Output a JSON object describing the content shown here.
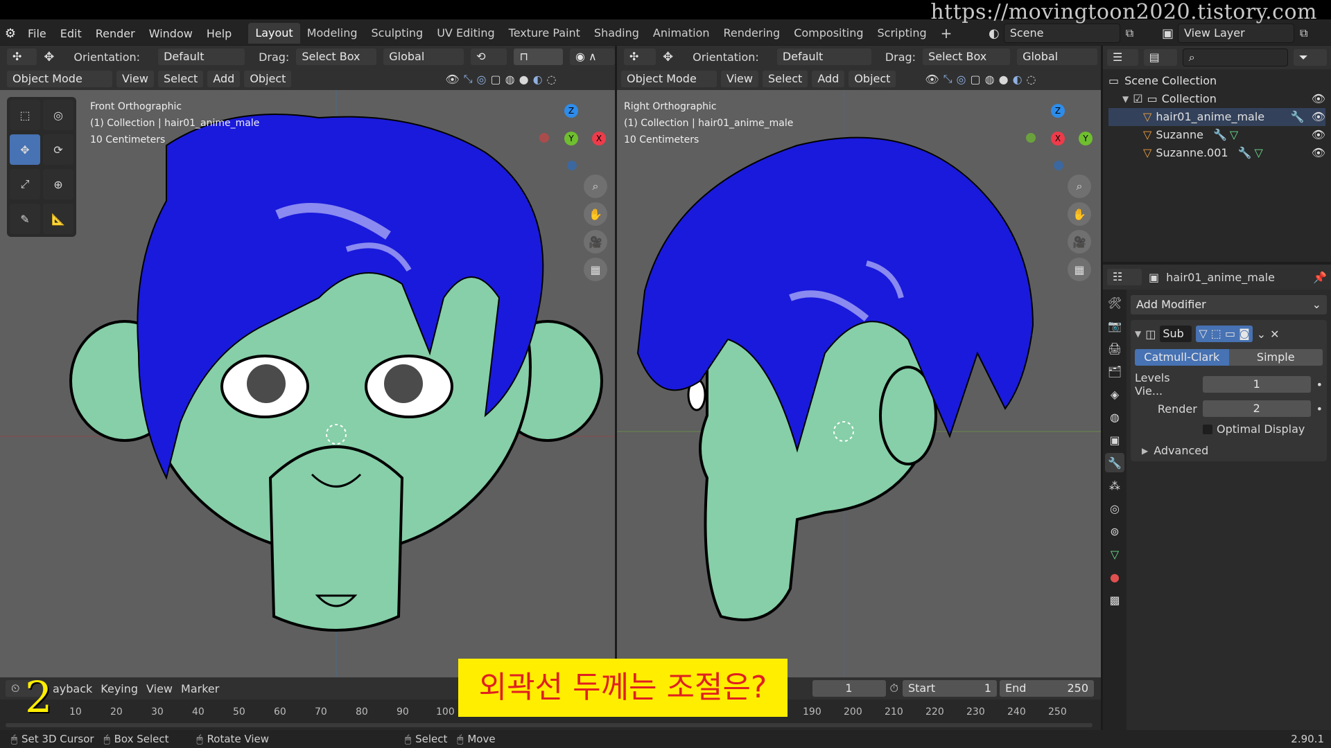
{
  "watermark": "https://movingtoon2020.tistory.com",
  "menu": [
    "File",
    "Edit",
    "Render",
    "Window",
    "Help"
  ],
  "workspaces": [
    "Layout",
    "Modeling",
    "Sculpting",
    "UV Editing",
    "Texture Paint",
    "Shading",
    "Animation",
    "Rendering",
    "Compositing",
    "Scripting"
  ],
  "active_workspace": "Layout",
  "scene": "Scene",
  "view_layer": "View Layer",
  "left_header": {
    "orientation_label": "Orientation:",
    "orientation": "Default",
    "drag_label": "Drag:",
    "drag": "Select Box",
    "transform": "Global",
    "mode": "Object Mode",
    "view": "View",
    "select": "Select",
    "add": "Add",
    "object": "Object"
  },
  "right_header": {
    "orientation_label": "Orientation:",
    "orientation": "Default",
    "drag_label": "Drag:",
    "drag": "Select Box",
    "transform": "Global",
    "mode": "Object Mode",
    "view": "View",
    "select": "Select",
    "add": "Add",
    "object": "Object"
  },
  "left_viewport": {
    "title": "Front Orthographic",
    "collection": "(1) Collection | hair01_anime_male",
    "scale": "10 Centimeters"
  },
  "right_viewport": {
    "title": "Right Orthographic",
    "collection": "(1) Collection | hair01_anime_male",
    "scale": "10 Centimeters"
  },
  "gizmo": {
    "z": "Z",
    "y": "Y",
    "x": "X"
  },
  "outliner": {
    "root": "Scene Collection",
    "collection": "Collection",
    "items": [
      "hair01_anime_male",
      "Suzanne",
      "Suzanne.001"
    ]
  },
  "properties": {
    "object_name": "hair01_anime_male",
    "add_modifier": "Add Modifier",
    "modifier_short": "Sub",
    "type_options": [
      "Catmull-Clark",
      "Simple"
    ],
    "levels_viewport_label": "Levels Vie...",
    "levels_viewport": "1",
    "render_label": "Render",
    "render": "2",
    "optimal_display": "Optimal Display",
    "advanced": "Advanced"
  },
  "timeline": {
    "playback": "ayback",
    "keying": "Keying",
    "view": "View",
    "marker": "Marker",
    "current_frame": "1",
    "start_label": "Start",
    "start": "1",
    "end_label": "End",
    "end": "250",
    "ticks_left": [
      "10",
      "20",
      "30",
      "40",
      "50",
      "60",
      "70",
      "80",
      "90",
      "100"
    ],
    "ticks_right": [
      "190",
      "200",
      "210",
      "220",
      "230",
      "240",
      "250"
    ],
    "step_number": "2"
  },
  "caption": "외곽선 두께는 조절은?",
  "status": {
    "set_cursor": "Set 3D Cursor",
    "box_select": "Box Select",
    "rotate_view": "Rotate View",
    "select": "Select",
    "move": "Move",
    "version": "2.90.1"
  },
  "colors": {
    "accent": "#4772b3",
    "hair": "#1a1adc",
    "skin": "#86cfa8",
    "viewport_bg": "#5f5f5f",
    "caption_bg": "#ffee00",
    "caption_text": "#e02020"
  }
}
